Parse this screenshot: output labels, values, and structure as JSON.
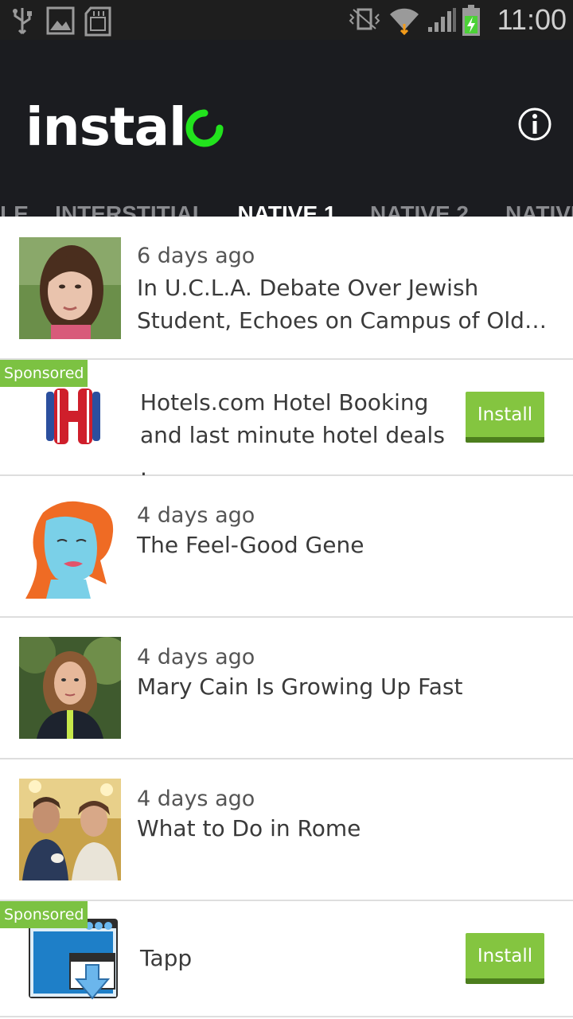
{
  "status_bar": {
    "time": "11:00",
    "icons": [
      "usb-icon",
      "image-icon",
      "sd-card-icon",
      "vibrate-icon",
      "wifi-icon",
      "signal-icon",
      "battery-charging-icon"
    ]
  },
  "app_bar": {
    "logo_text": "instal",
    "info_icon": "info-icon"
  },
  "tabs": [
    {
      "label": "LE",
      "active": false
    },
    {
      "label": "INTERSTITIAL",
      "active": false
    },
    {
      "label": "NATIVE 1",
      "active": true
    },
    {
      "label": "NATIVE 2",
      "active": false
    },
    {
      "label": "NATIVE",
      "active": false
    }
  ],
  "colors": {
    "accent_green": "#22e31d",
    "sponsored_green": "#7cc242",
    "install_green": "#84c540",
    "app_bar": "#1b1c20"
  },
  "list": {
    "items": [
      {
        "type": "article",
        "meta": "6 days ago",
        "title_line1": "In U.C.L.A. Debate Over Jewish",
        "title_line2": "Student, Echoes on Campus of Old…"
      },
      {
        "type": "ad",
        "sponsored": "Sponsored",
        "title_line1": "Hotels.com Hotel Booking",
        "title_line2": "and last minute hotel deals .",
        "cta": "Install",
        "icon": "hotels-logo-icon"
      },
      {
        "type": "article",
        "meta": "4 days ago",
        "title_line1": "The Feel-Good Gene"
      },
      {
        "type": "article",
        "meta": "4 days ago",
        "title_line1": "Mary Cain Is Growing Up Fast"
      },
      {
        "type": "article",
        "meta": "4 days ago",
        "title_line1": "What to Do in Rome"
      },
      {
        "type": "ad",
        "sponsored": "Sponsored",
        "title_line1": "Tapp",
        "cta": "Install",
        "icon": "tapp-app-icon"
      }
    ]
  }
}
